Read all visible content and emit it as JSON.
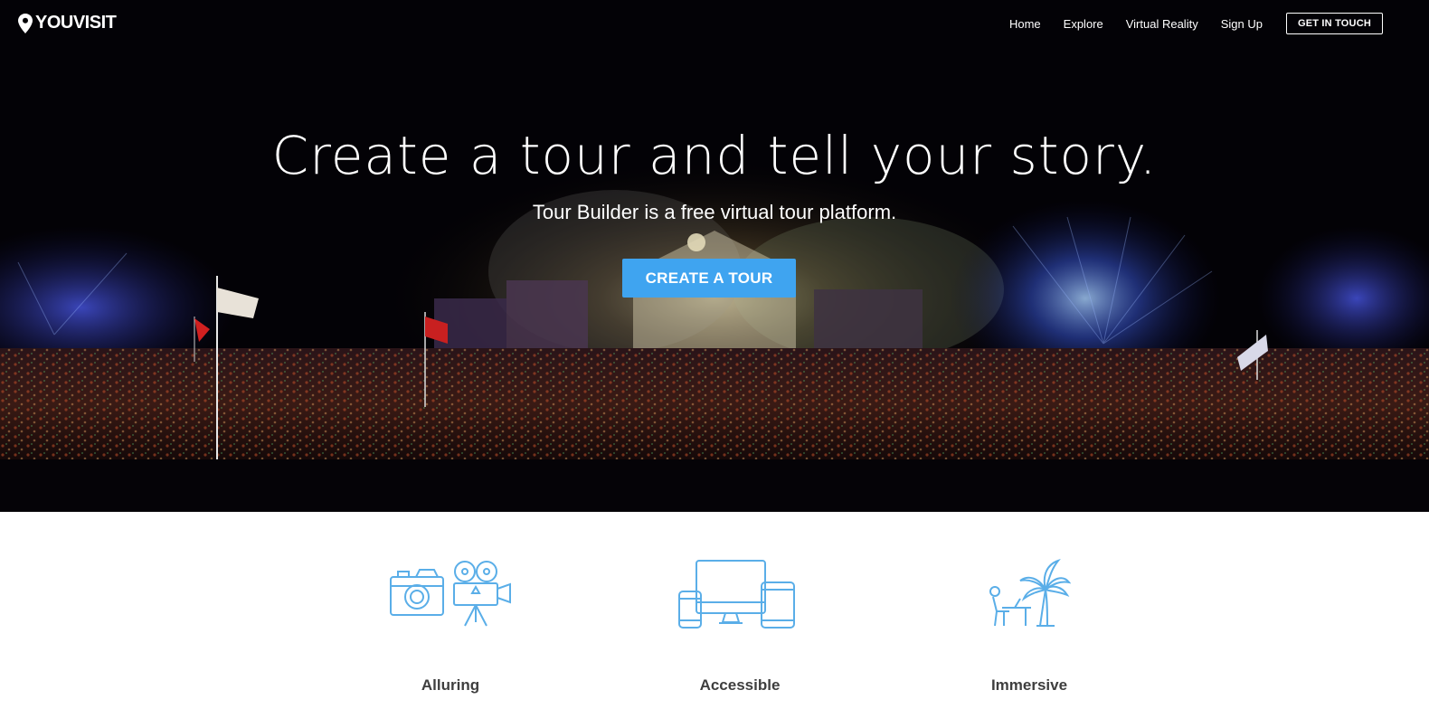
{
  "brand": {
    "name": "YOUVISIT",
    "icon": "map-pin-icon"
  },
  "nav": {
    "items": [
      {
        "label": "Home"
      },
      {
        "label": "Explore"
      },
      {
        "label": "Virtual Reality"
      },
      {
        "label": "Sign Up"
      }
    ],
    "cta_label": "GET IN TOUCH"
  },
  "hero": {
    "headline": "Create a tour and tell your story.",
    "subheadline": "Tour Builder is a free virtual tour platform.",
    "button_label": "CREATE A TOUR",
    "background": "night festival crowd panorama",
    "button_color": "#3fa4f0"
  },
  "features": [
    {
      "title": "Alluring",
      "icon": "camera-and-movie-camera-icon"
    },
    {
      "title": "Accessible",
      "icon": "devices-icon"
    },
    {
      "title": "Immersive",
      "icon": "person-at-desk-with-palm-tree-icon"
    }
  ],
  "colors": {
    "accent": "#3fa4f0",
    "icon_line": "#5aaee8",
    "feature_title": "#3e3e3e",
    "hero_bg": "#020104"
  }
}
